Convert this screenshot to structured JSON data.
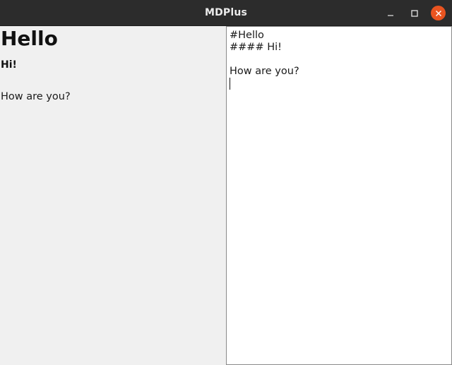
{
  "window": {
    "title": "MDPlus",
    "controls": {
      "minimize_icon": "minimize-icon",
      "maximize_icon": "maximize-icon",
      "close_icon": "close-icon",
      "close_color": "#e95420"
    }
  },
  "preview": {
    "heading1": "Hello",
    "heading4": "Hi!",
    "paragraph": "How are you?"
  },
  "editor": {
    "lines": [
      "#Hello",
      "#### Hi!",
      "",
      "How are you?",
      ""
    ]
  }
}
